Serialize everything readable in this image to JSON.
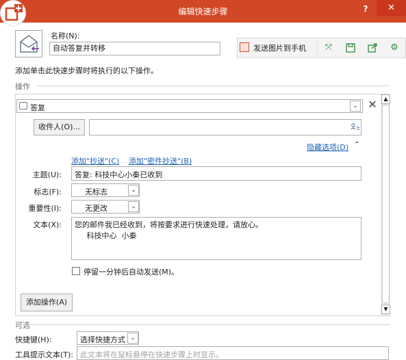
{
  "window": {
    "title": "编辑快速步骤",
    "help_label": "?",
    "close_label": "✕",
    "accent_color": "#d24726"
  },
  "name": {
    "label": "名称(N):",
    "value": "自动答复并转移"
  },
  "toolbar": {
    "send_to_phone_label": "发送图片到手机",
    "icons": [
      "expand-icon",
      "save-icon",
      "export-icon",
      "settings-icon"
    ]
  },
  "description": "添加单击此快速步骤时将执行的以下操作。",
  "actions_group": {
    "label": "操作",
    "action": {
      "label": "答复",
      "icon": "reply-icon"
    },
    "recipients_button_label": "收件人(O)...",
    "recipients_value": "",
    "hide_options_label": "隐藏选项(D)",
    "add_cc_label": "添加\"抄送\"(C)",
    "add_bcc_label": "添加\"密件抄送\"(B)",
    "subject_label": "主题(U):",
    "subject_value": "答复: 科技中心小秦已收到",
    "flag_label": "标志(F):",
    "flag_value": "无标志",
    "importance_label": "重要性(I):",
    "importance_value": "无更改",
    "body_label": "文本(X):",
    "body_value": "您的邮件我已经收到，将按要求进行快速处理，请放心。\n     科技中心  小秦",
    "autosend_label": "停留一分钟后自动发送(M)。",
    "autosend_checked": false,
    "add_action_label": "添加操作(A)"
  },
  "optional_group": {
    "label": "可选",
    "shortcut_label": "快捷键(H):",
    "shortcut_value": "选择快捷方式",
    "tooltip_label": "工具提示文本(T):",
    "tooltip_placeholder": "此文本将在鼠标悬停在快速步骤上时显示。"
  }
}
